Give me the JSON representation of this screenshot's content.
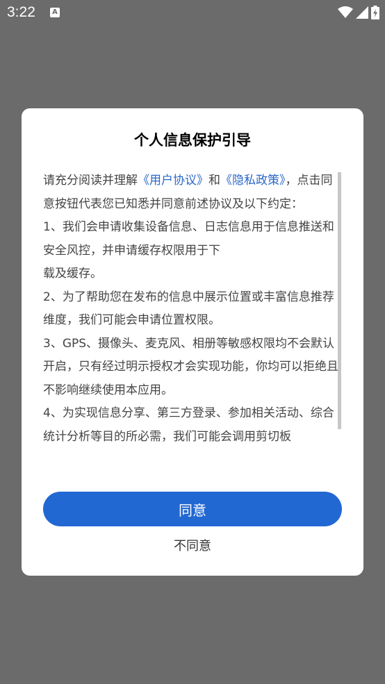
{
  "status_bar": {
    "time": "3:22",
    "notification_icon_letter": "A",
    "icons": [
      "wifi-icon",
      "signal-icon",
      "battery-charging-icon"
    ]
  },
  "dialog": {
    "title": "个人信息保护引导",
    "intro": {
      "before": "请充分阅读并理解",
      "link1": "《用户协议》",
      "middle": "和",
      "link2": "《隐私政策》",
      "after": "，点击同意按钮代表您已知悉并同意前述协议及以下约定："
    },
    "items": [
      "1、我们会申请收集设备信息、日志信息用于信息推送和安全风控，并申请缓存权限用于下",
      "载及缓存。",
      "2、为了帮助您在发布的信息中展示位置或丰富信息推荐维度，我们可能会申请位置权限。",
      "3、GPS、摄像头、麦克风、相册等敏感权限均不会默认开启，只有经过明示授权才会实现功能，你均可以拒绝且不影响继续使用本应用。",
      "4、为实现信息分享、第三方登录、参加相关活动、综合统计分析等目的所必需，我们可能会调用剪切板"
    ],
    "agree_label": "同意",
    "disagree_label": "不同意"
  },
  "colors": {
    "overlay": "#6b6b6b",
    "link": "#2b67c9",
    "primary_button": "#2268d3"
  }
}
